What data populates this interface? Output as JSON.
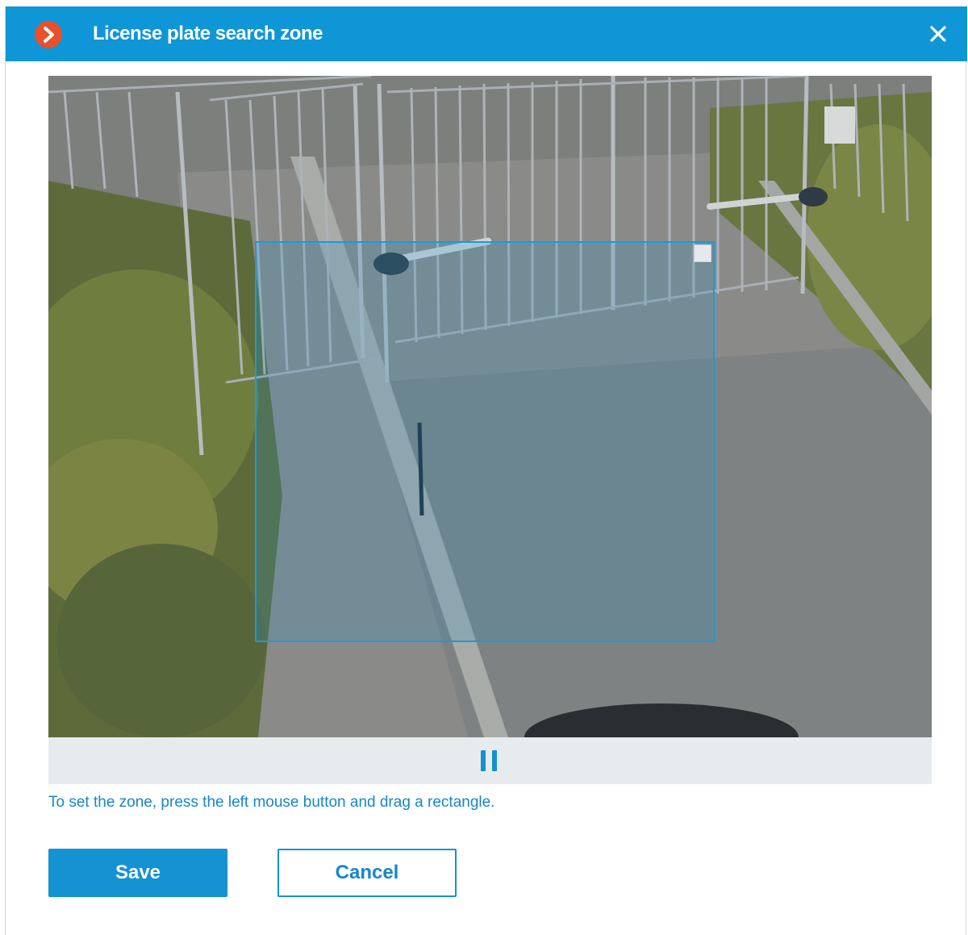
{
  "window": {
    "title": "License plate search zone",
    "accent_color": "#0f96d6",
    "app_icon": "chevron-right-icon",
    "close_icon": "close-icon"
  },
  "video": {
    "description_icon": "camera-view",
    "zone_color": "#1a9bdc"
  },
  "controls": {
    "pause_icon": "pause-icon"
  },
  "hint": {
    "text": "To set the zone,  press the left mouse button and drag a rectangle."
  },
  "buttons": {
    "save_label": "Save",
    "cancel_label": "Cancel"
  }
}
